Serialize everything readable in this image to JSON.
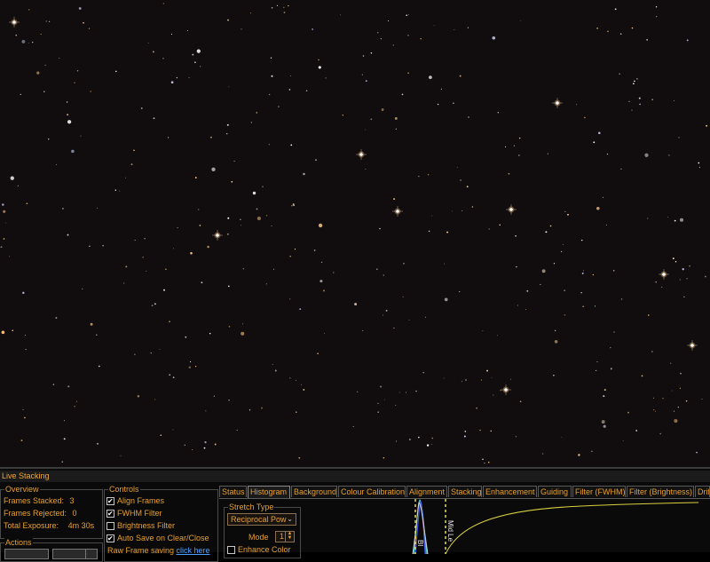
{
  "panel": {
    "title": "Live Stacking",
    "overview": {
      "label": "Overview",
      "frames_stacked_label": "Frames Stacked:",
      "frames_stacked_value": "3",
      "frames_rejected_label": "Frames Rejected:",
      "frames_rejected_value": "0",
      "total_exposure_label": "Total Exposure:",
      "total_exposure_value": "4m 30s"
    },
    "actions": {
      "label": "Actions"
    },
    "controls": {
      "label": "Controls",
      "items": [
        {
          "label": "Align Frames",
          "checked": true
        },
        {
          "label": "FWHM Filter",
          "checked": true
        },
        {
          "label": "Brightness Filter",
          "checked": false
        },
        {
          "label": "Auto Save on Clear/Close",
          "checked": true
        }
      ],
      "raw_saving_label": "Raw Frame saving",
      "raw_saving_link": "click here"
    },
    "tabs": [
      "Status",
      "Histogram",
      "Background",
      "Colour Calibration",
      "Alignment",
      "Stacking",
      "Enhancement",
      "Guiding",
      "Filter (FWHM)",
      "Filter (Brightness)",
      "Drift"
    ],
    "active_tab": "Histogram",
    "histogram": {
      "stretch_type_label": "Stretch Type",
      "stretch_type_value": "Reciprocal Pow",
      "mode_label": "Mode",
      "mode_value": "1",
      "enhance_color_label": "Enhance Color",
      "enhance_color_checked": false,
      "black_level_label": "Bl",
      "mid_level_label": "Mid Le"
    }
  },
  "colors": {
    "accent": "#e8a030",
    "sky": "#110c0d",
    "link": "#4aa0ff"
  }
}
